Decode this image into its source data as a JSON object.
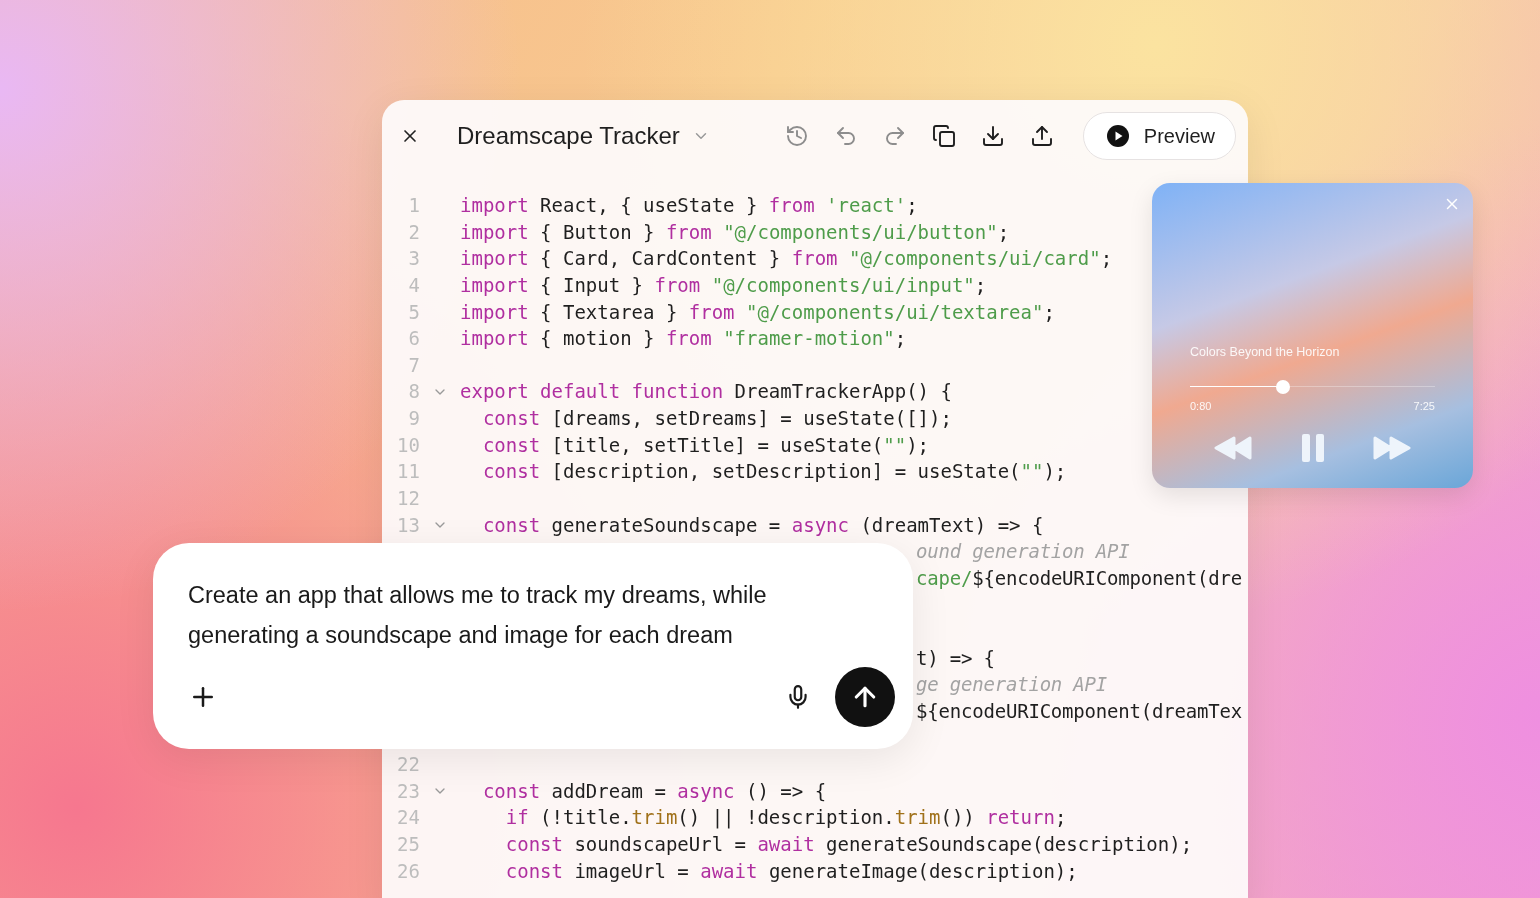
{
  "editor": {
    "title": "Dreamscape Tracker",
    "toolbar": [
      {
        "kind": "history",
        "disabled": true
      },
      {
        "kind": "undo",
        "disabled": true
      },
      {
        "kind": "redo",
        "disabled": true
      },
      {
        "kind": "copy",
        "disabled": false
      },
      {
        "kind": "download",
        "disabled": false
      },
      {
        "kind": "upload",
        "disabled": false
      }
    ],
    "preview_button": "Preview",
    "lines": [
      {
        "number": "1",
        "tokens": [
          {
            "kind": "kw",
            "text": "import"
          },
          {
            "kind": "plain",
            "text": " React, { useState } "
          },
          {
            "kind": "kw",
            "text": "from"
          },
          {
            "kind": "str",
            "text": " 'react'"
          },
          {
            "kind": "plain",
            "text": ";"
          }
        ]
      },
      {
        "number": "2",
        "tokens": [
          {
            "kind": "kw",
            "text": "import"
          },
          {
            "kind": "plain",
            "text": " { Button } "
          },
          {
            "kind": "kw",
            "text": "from"
          },
          {
            "kind": "str",
            "text": " \"@/components/ui/button\""
          },
          {
            "kind": "plain",
            "text": ";"
          }
        ]
      },
      {
        "number": "3",
        "tokens": [
          {
            "kind": "kw",
            "text": "import"
          },
          {
            "kind": "plain",
            "text": " { Card, CardContent } "
          },
          {
            "kind": "kw",
            "text": "from"
          },
          {
            "kind": "str",
            "text": " \"@/components/ui/card\""
          },
          {
            "kind": "plain",
            "text": ";"
          }
        ]
      },
      {
        "number": "4",
        "tokens": [
          {
            "kind": "kw",
            "text": "import"
          },
          {
            "kind": "plain",
            "text": " { Input } "
          },
          {
            "kind": "kw",
            "text": "from"
          },
          {
            "kind": "str",
            "text": " \"@/components/ui/input\""
          },
          {
            "kind": "plain",
            "text": ";"
          }
        ]
      },
      {
        "number": "5",
        "tokens": [
          {
            "kind": "kw",
            "text": "import"
          },
          {
            "kind": "plain",
            "text": " { Textarea } "
          },
          {
            "kind": "kw",
            "text": "from"
          },
          {
            "kind": "str",
            "text": " \"@/components/ui/textarea\""
          },
          {
            "kind": "plain",
            "text": ";"
          }
        ]
      },
      {
        "number": "6",
        "tokens": [
          {
            "kind": "kw",
            "text": "import"
          },
          {
            "kind": "plain",
            "text": " { motion } "
          },
          {
            "kind": "kw",
            "text": "from"
          },
          {
            "kind": "str",
            "text": " \"framer-motion\""
          },
          {
            "kind": "plain",
            "text": ";"
          }
        ]
      },
      {
        "number": "7"
      },
      {
        "number": "8",
        "fold": true,
        "tokens": [
          {
            "kind": "kw",
            "text": "export default function"
          },
          {
            "kind": "plain",
            "text": " DreamTrackerApp() {"
          }
        ]
      },
      {
        "number": "9",
        "tokens": [
          {
            "kind": "kw",
            "text": "  const"
          },
          {
            "kind": "plain",
            "text": " [dreams, setDreams] = useState([]);"
          }
        ]
      },
      {
        "number": "10",
        "tokens": [
          {
            "kind": "kw",
            "text": "  const"
          },
          {
            "kind": "plain",
            "text": " [title, setTitle] = useState("
          },
          {
            "kind": "str",
            "text": "\"\""
          },
          {
            "kind": "plain",
            "text": ");"
          }
        ]
      },
      {
        "number": "11",
        "tokens": [
          {
            "kind": "kw",
            "text": "  const"
          },
          {
            "kind": "plain",
            "text": " [description, setDescription] = useState("
          },
          {
            "kind": "str",
            "text": "\"\""
          },
          {
            "kind": "plain",
            "text": ");"
          }
        ]
      },
      {
        "number": "12"
      },
      {
        "number": "13",
        "fold": true,
        "tokens": [
          {
            "kind": "kw",
            "text": "  const"
          },
          {
            "kind": "plain",
            "text": " generateSoundscape = "
          },
          {
            "kind": "kw",
            "text": "async"
          },
          {
            "kind": "plain",
            "text": " (dreamText) => {"
          }
        ]
      },
      {
        "covered": true,
        "tokens": [
          {
            "kind": "comment",
            "text": "ound generation API"
          }
        ]
      },
      {
        "covered": true,
        "tokens": [
          {
            "kind": "str",
            "text": "cape/"
          },
          {
            "kind": "plain",
            "text": "${encodeURIComponent(dre"
          }
        ]
      },
      {
        "covered": true
      },
      {
        "covered": true
      },
      {
        "covered": true,
        "tokens": [
          {
            "kind": "plain",
            "text": "t) => {"
          }
        ]
      },
      {
        "covered": true,
        "tokens": [
          {
            "kind": "comment",
            "text": "ge generation API"
          }
        ]
      },
      {
        "covered": true,
        "tokens": [
          {
            "kind": "plain",
            "text": "${encodeURIComponent(dreamTex"
          }
        ]
      },
      {
        "covered": true
      },
      {
        "number": "22"
      },
      {
        "number": "23",
        "fold": true,
        "tokens": [
          {
            "kind": "kw",
            "text": "  const"
          },
          {
            "kind": "plain",
            "text": " addDream = "
          },
          {
            "kind": "kw",
            "text": "async"
          },
          {
            "kind": "plain",
            "text": " () => {"
          }
        ]
      },
      {
        "number": "24",
        "tokens": [
          {
            "kind": "kw",
            "text": "    if"
          },
          {
            "kind": "plain",
            "text": " (!title."
          },
          {
            "kind": "fn",
            "text": "trim"
          },
          {
            "kind": "plain",
            "text": "() || !description."
          },
          {
            "kind": "fn",
            "text": "trim"
          },
          {
            "kind": "plain",
            "text": "()) "
          },
          {
            "kind": "kw",
            "text": "return"
          },
          {
            "kind": "plain",
            "text": ";"
          }
        ]
      },
      {
        "number": "25",
        "tokens": [
          {
            "kind": "kw",
            "text": "    const"
          },
          {
            "kind": "plain",
            "text": " soundscapeUrl = "
          },
          {
            "kind": "kw",
            "text": "await"
          },
          {
            "kind": "plain",
            "text": " generateSoundscape(description);"
          }
        ]
      },
      {
        "number": "26",
        "tokens": [
          {
            "kind": "kw",
            "text": "    const"
          },
          {
            "kind": "plain",
            "text": " imageUrl = "
          },
          {
            "kind": "kw",
            "text": "await"
          },
          {
            "kind": "plain",
            "text": " generateImage(description);"
          }
        ]
      }
    ]
  },
  "player": {
    "title": "Colors Beyond the Horizon",
    "level": 0.38,
    "elapsed": "0:80",
    "duration": "7:25",
    "playing": true
  },
  "prompt": {
    "value": "Create an app that allows me to track my dreams, while generating a soundscape and image for each dream"
  }
}
